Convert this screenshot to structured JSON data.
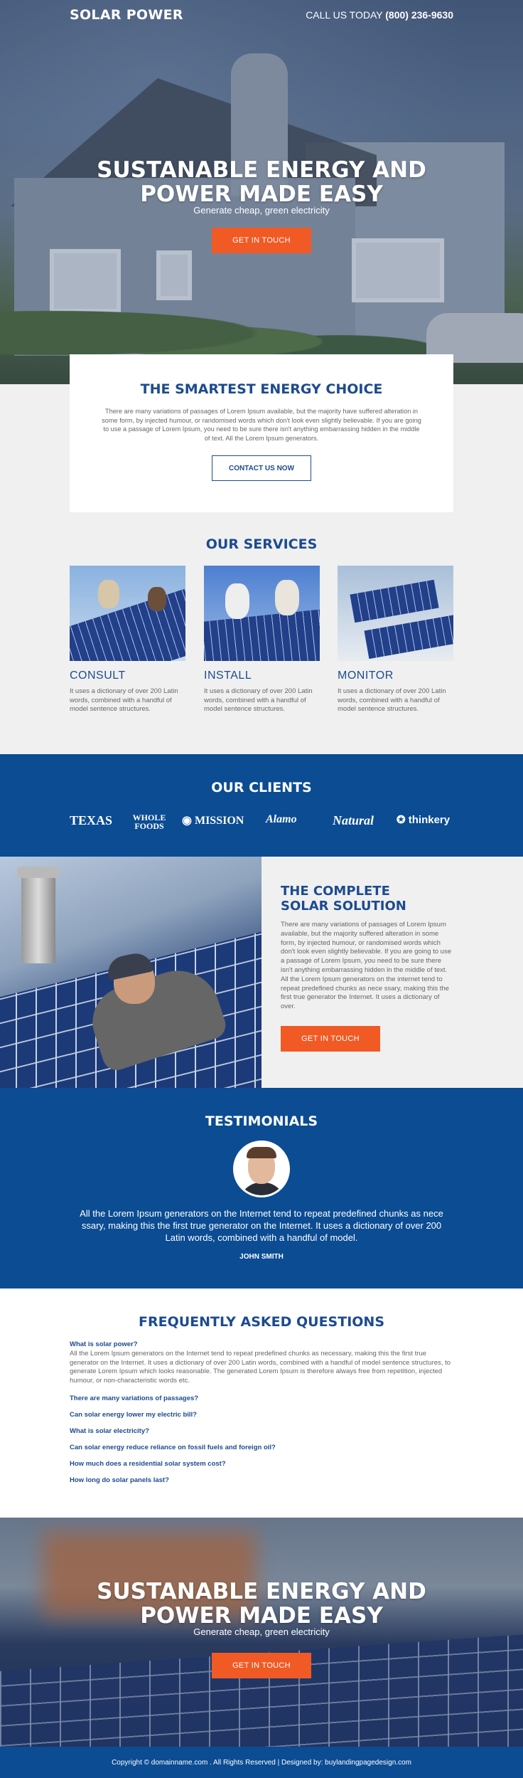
{
  "header": {
    "brand": "SOLAR POWER",
    "call_label": "CALL US TODAY",
    "phone": "(800) 236-9630"
  },
  "hero": {
    "title_line1": "SUSTANABLE ENERGY AND",
    "title_line2": "POWER MADE EASY",
    "subtitle": "Generate cheap, green electricity",
    "button": "GET IN TOUCH"
  },
  "smart": {
    "title": "THE SMARTEST ENERGY CHOICE",
    "body": "There are many variations of passages of Lorem Ipsum available, but the majority have suffered alteration in some form, by injected humour, or randomised words which don't look even slightly believable. If you are going to use a passage of Lorem Ipsum, you need to be sure there isn't anything embarrassing hidden in the middle of text. All the Lorem Ipsum generators.",
    "button": "CONTACT US NOW"
  },
  "services": {
    "title": "OUR SERVICES",
    "items": [
      {
        "name": "CONSULT",
        "text": "It uses a dictionary of over 200 Latin words, combined with a handful of model sentence structures."
      },
      {
        "name": "INSTALL",
        "text": "It uses a dictionary of over 200 Latin words, combined with a handful of model sentence structures."
      },
      {
        "name": "MONITOR",
        "text": "It uses a dictionary of over 200 Latin words, combined with a handful of model sentence structures."
      }
    ]
  },
  "clients": {
    "title": "OUR CLIENTS",
    "logos": [
      "TEXAS",
      "WHOLE FOODS",
      "MISSION",
      "Alamo",
      "Natural",
      "thinkery"
    ]
  },
  "complete": {
    "title_line1": "THE COMPLETE",
    "title_line2": "SOLAR SOLUTION",
    "body": "There are many variations of passages of Lorem Ipsum available, but the majority suffered alteration in some form, by injected humour, or randomised words which don't look even slightly believable. If you are going to use a passage of Lorem Ipsum, you need to be sure there isn't anything embarrassing hidden in the middle of text. All the Lorem Ipsum generators on the internet tend to repeat predefined chunks as nece ssary, making this the first true generator the Internet. It uses a dictionary of over.",
    "button": "GET IN TOUCH"
  },
  "testimonials": {
    "title": "TESTIMONIALS",
    "quote": "All the Lorem Ipsum generators on the Internet tend to repeat predefined chunks as nece ssary, making this the first true generator on the Internet. It uses a dictionary of over 200 Latin words, combined with a handful of model.",
    "author": "JOHN SMITH"
  },
  "faq": {
    "title": "FREQUENTLY ASKED QUESTIONS",
    "open_question": "What is solar power?",
    "open_answer": "All the Lorem Ipsum generators on the Internet tend to repeat predefined chunks as necessary, making this the first true generator on the Internet. It uses a dictionary of over 200 Latin words, combined with a handful of model sentence structures, to generate Lorem Ipsum which looks reasonable. The generated Lorem Ipsum is therefore always free from repetition, injected humour, or non-characteristic words etc.",
    "questions": [
      "There are many variations of passages?",
      "Can solar energy lower my electric bill?",
      "What is solar electricity?",
      "Can solar energy reduce reliance on fossil fuels and foreign oil?",
      "How much does a residential solar system cost?",
      "How long do solar panels last?"
    ]
  },
  "cta": {
    "title_line1": "SUSTANABLE ENERGY AND",
    "title_line2": "POWER MADE EASY",
    "subtitle": "Generate cheap, green electricity",
    "button": "GET IN TOUCH"
  },
  "footer": {
    "text": "Copyright © domainname.com . All Rights Reserved | Designed by: buylandingpagedesign.com"
  },
  "colors": {
    "primary_blue": "#0b4c93",
    "heading_blue": "#1c4b8f",
    "accent_orange": "#f15a24"
  }
}
